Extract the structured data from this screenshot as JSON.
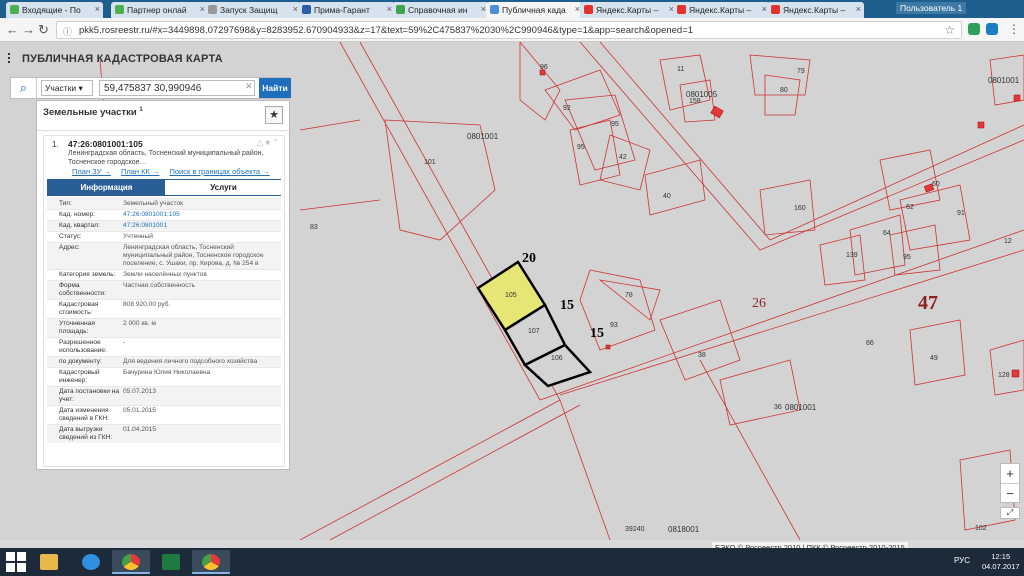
{
  "browser": {
    "tabs": [
      {
        "label": "Входящие - По",
        "color": "#4caf50"
      },
      {
        "label": "Партнер онлай",
        "color": "#4caf50"
      },
      {
        "label": "Запуск Защищ",
        "color": "#999999"
      },
      {
        "label": "Прима-Гарант",
        "color": "#2b5ea7"
      },
      {
        "label": "Справочная ин",
        "color": "#3fa34d"
      },
      {
        "label": "Публичная када",
        "color": "#4a90d9"
      },
      {
        "label": "Яндекс.Карты –",
        "color": "#e5322d"
      },
      {
        "label": "Яндекс.Карты –",
        "color": "#e5322d"
      },
      {
        "label": "Яндекс.Карты –",
        "color": "#e5322d"
      }
    ],
    "active_tab": 5,
    "user_label": "Пользователь 1",
    "url": "pkk5.rosreestr.ru/#x=3449898.07297698&y=8283952.670904933&z=17&text=59%2C475837%2030%2C990946&type=1&app=search&opened=1"
  },
  "app": {
    "title": "ПУБЛИЧНАЯ КАДАСТРОВАЯ КАРТА"
  },
  "search": {
    "type": "Участки",
    "query": "59,475837 30,990946",
    "button": "Найти"
  },
  "panel": {
    "title": "Земельные участки",
    "count": "1",
    "item": {
      "num": "1.",
      "cad": "47:26:0801001:105",
      "address_short": "Ленинградская область, Тосненский муниципальный район, Тосненское городское…",
      "links": [
        "План ЗУ →",
        "План КК →",
        "Поиск в границах объекта →"
      ],
      "tabs": [
        "Информация",
        "Услуги"
      ],
      "rows": [
        {
          "k": "Тип:",
          "v": "Земельный участок",
          "link": false
        },
        {
          "k": "Кад. номер:",
          "v": "47:26:0801001:105",
          "link": true
        },
        {
          "k": "Кад. квартал:",
          "v": "47:26:0801001",
          "link": true
        },
        {
          "k": "Статус:",
          "v": "Учтенный",
          "link": false
        },
        {
          "k": "Адрес:",
          "v": "Ленинградская область, Тосненский муниципальный район, Тосненское городское поселение, с. Ушаки, пр. Кирова, д. № 254 в",
          "link": false
        },
        {
          "k": "Категория земель:",
          "v": "Земли населённых пунктов",
          "link": false
        },
        {
          "k": "Форма собственности:",
          "v": "Частная собственность",
          "link": false
        },
        {
          "k": "Кадастровая стоимость:",
          "v": "808 920,00 руб.",
          "link": false
        },
        {
          "k": "Уточненная площадь:",
          "v": "2 000 кв. м",
          "link": false
        },
        {
          "k": "Разрешенное использование:",
          "v": "-",
          "link": false
        },
        {
          "k": "по документу:",
          "v": "Для ведения личного подсобного хозяйства",
          "link": false
        },
        {
          "k": "Кадастровый инженер:",
          "v": "Бачурина Юлия Николаевна",
          "link": false
        },
        {
          "k": "Дата постановки на учет:",
          "v": "05.07.2013",
          "link": false
        },
        {
          "k": "Дата изменения сведений в ГКН:",
          "v": "05.01.2015",
          "link": false
        },
        {
          "k": "Дата выгрузки сведений из ГКН:",
          "v": "01.04.2015",
          "link": false
        }
      ]
    }
  },
  "map": {
    "distances": {
      "d20": "20",
      "d15a": "15",
      "d15b": "15"
    },
    "big_labels": {
      "q26": "26",
      "q47": "47"
    },
    "quarter_labels": {
      "q1": "0801001",
      "q2": "0801005",
      "q3": "0801001",
      "q4": "0801001",
      "q5": "0818001"
    },
    "parcel_labels": [
      "105",
      "107",
      "106",
      "101",
      "83",
      "96",
      "92",
      "95",
      "95",
      "42",
      "11",
      "158",
      "79",
      "80",
      "40",
      "160",
      "60",
      "62",
      "91",
      "64",
      "139",
      "95",
      "78",
      "93",
      "38",
      "12",
      "49",
      "128",
      "36",
      "66",
      "39240",
      "102"
    ],
    "zoom_in": "+",
    "zoom_out": "−",
    "attribution": "ЕЭКО © Росреестр 2010 | ПКК © Росреестр 2010-2015"
  },
  "taskbar": {
    "lang": "РУС",
    "time": "12:15",
    "date": "04.07.2017"
  }
}
